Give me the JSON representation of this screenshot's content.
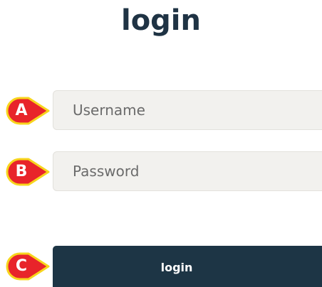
{
  "page": {
    "title": "login"
  },
  "form": {
    "username_placeholder": "Username",
    "password_placeholder": "Password",
    "login_button_label": "login"
  },
  "callouts": {
    "a": "A",
    "b": "B",
    "c": "C"
  },
  "colors": {
    "title": "#1f3344",
    "field_background": "#f2f1ee",
    "button_background": "#1d3545",
    "callout_fill": "#e8242a",
    "callout_border": "#f7d51d"
  }
}
